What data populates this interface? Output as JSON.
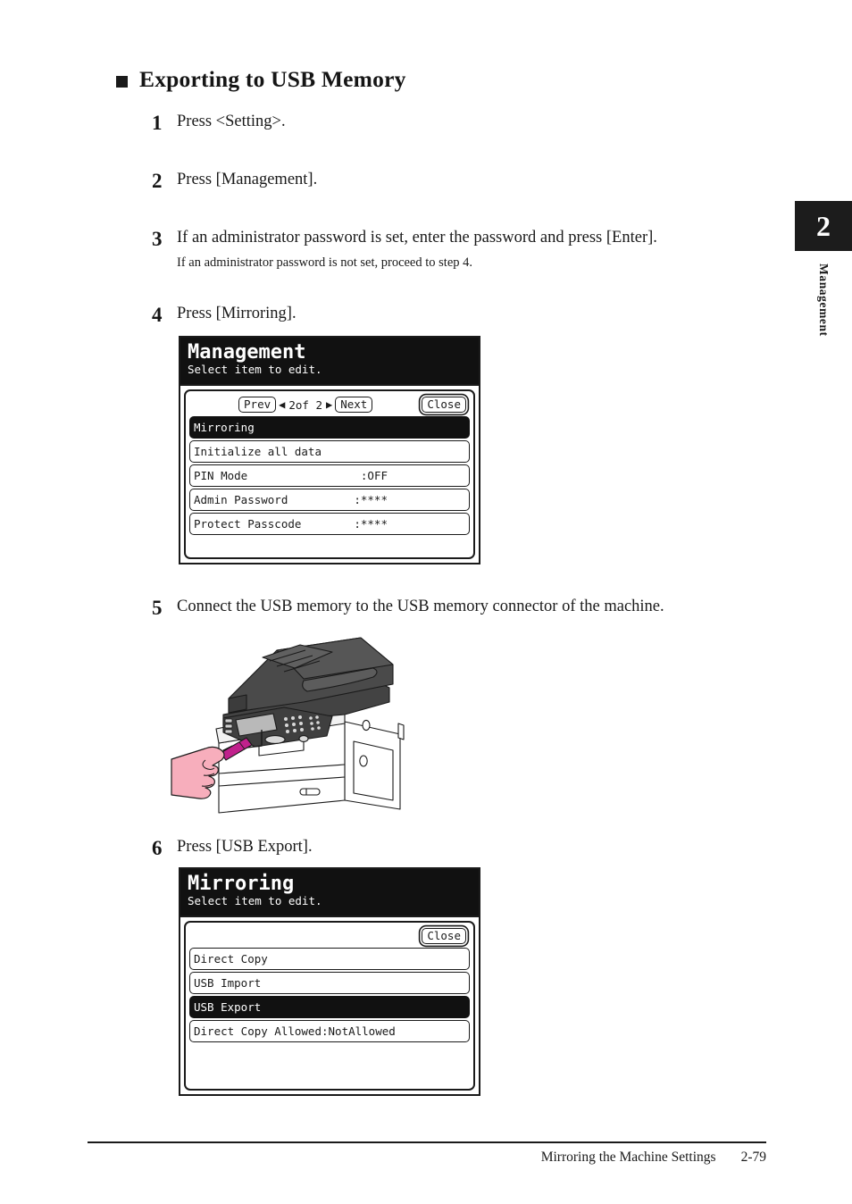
{
  "page": {
    "heading": "Exporting to USB Memory",
    "bullet": "square-bullet"
  },
  "chapter_tab": {
    "number": "2",
    "label": "Management"
  },
  "steps": [
    {
      "number": "1",
      "text": "Press <Setting>."
    },
    {
      "number": "2",
      "text": "Press [Management]."
    },
    {
      "number": "3",
      "text": "If an administrator password is set, enter the password and press [Enter].",
      "sub": "If an administrator password is not set, proceed to step 4."
    },
    {
      "number": "4",
      "text": "Press [Mirroring]."
    },
    {
      "number": "5",
      "text": "Connect the USB memory to the USB memory connector of the machine."
    },
    {
      "number": "6",
      "text": "Press [USB Export]."
    }
  ],
  "lcd_management": {
    "title": "Management",
    "subtitle": "Select item to edit.",
    "toolbar": {
      "prev_label": "Prev",
      "left_arrow": "◀",
      "pager": "2of  2",
      "right_arrow": "▶",
      "next_label": "Next",
      "close_label": "Close"
    },
    "rows": [
      {
        "label": "Mirroring",
        "value": "",
        "selected": true
      },
      {
        "label": "Initialize all data",
        "value": "",
        "selected": false
      },
      {
        "label": "PIN Mode",
        "value": ":OFF",
        "selected": false
      },
      {
        "label": "Admin Password",
        "value": ":****",
        "selected": false
      },
      {
        "label": "Protect Passcode",
        "value": ":****",
        "selected": false
      }
    ]
  },
  "lcd_mirroring": {
    "title": "Mirroring",
    "subtitle": "Select item to edit.",
    "toolbar": {
      "close_label": "Close"
    },
    "rows": [
      {
        "label": "Direct Copy",
        "value": "",
        "selected": false
      },
      {
        "label": "USB Import",
        "value": "",
        "selected": false
      },
      {
        "label": "USB Export",
        "value": "",
        "selected": true
      },
      {
        "label": "Direct Copy Allowed:NotAllowed",
        "value": "",
        "selected": false
      }
    ]
  },
  "illustration": {
    "name": "multifunction-printer-usb-insert",
    "colors": {
      "body": "#ffffff",
      "adf_dark": "#4a4a4a",
      "panel_gray": "#9a9a9a",
      "hand_pink": "#f7aebc",
      "usb_magenta": "#c0218c",
      "outline": "#1a1a1a"
    }
  },
  "footer": {
    "section": "Mirroring the Machine Settings",
    "page_number": "2-79"
  }
}
